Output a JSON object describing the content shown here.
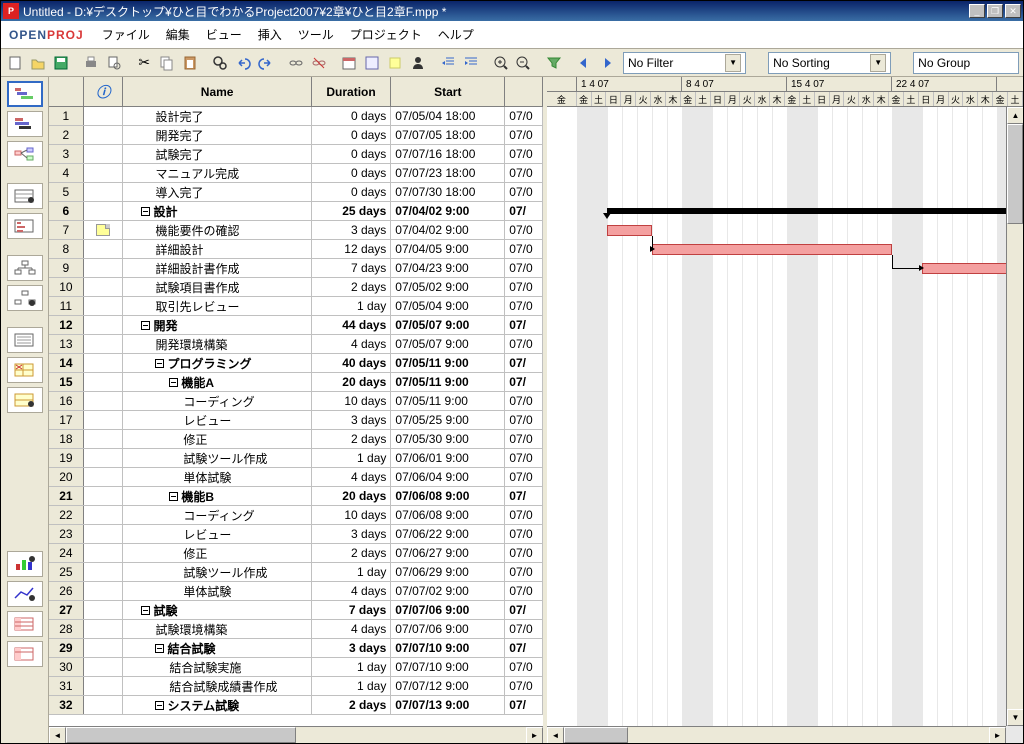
{
  "window": {
    "title": "Untitled - D:¥デスクトップ¥ひと目でわかるProject2007¥2章¥ひと目2章F.mpp *"
  },
  "logo": {
    "open": "OPEN",
    "proj": "PROJ"
  },
  "menu": {
    "file": "ファイル",
    "edit": "編集",
    "view": "ビュー",
    "insert": "挿入",
    "tool": "ツール",
    "project": "プロジェクト",
    "help": "ヘルプ"
  },
  "combos": {
    "filter": "No Filter",
    "sort": "No Sorting",
    "group": "No Group"
  },
  "headers": {
    "indicator": "ⓘ",
    "name": "Name",
    "duration": "Duration",
    "start": "Start"
  },
  "timeline": {
    "weeks": [
      "1 4 07",
      "8 4 07",
      "15 4 07",
      "22 4 07"
    ],
    "days": [
      "金",
      "土",
      "日",
      "月",
      "火",
      "水",
      "木",
      "金",
      "土",
      "日",
      "月",
      "火",
      "水",
      "木",
      "金",
      "土",
      "日",
      "月",
      "火",
      "水",
      "木",
      "金",
      "土",
      "日",
      "月",
      "火",
      "水",
      "木",
      "金",
      "土"
    ]
  },
  "tasks": [
    {
      "id": 1,
      "ind": "",
      "name": "設計完了",
      "dur": "0 days",
      "start": "07/05/04 18:00",
      "fin": "07/0",
      "indent": 2,
      "sum": false
    },
    {
      "id": 2,
      "ind": "",
      "name": "開発完了",
      "dur": "0 days",
      "start": "07/07/05 18:00",
      "fin": "07/0",
      "indent": 2,
      "sum": false
    },
    {
      "id": 3,
      "ind": "",
      "name": "試験完了",
      "dur": "0 days",
      "start": "07/07/16 18:00",
      "fin": "07/0",
      "indent": 2,
      "sum": false
    },
    {
      "id": 4,
      "ind": "",
      "name": "マニュアル完成",
      "dur": "0 days",
      "start": "07/07/23 18:00",
      "fin": "07/0",
      "indent": 2,
      "sum": false
    },
    {
      "id": 5,
      "ind": "",
      "name": "導入完了",
      "dur": "0 days",
      "start": "07/07/30 18:00",
      "fin": "07/0",
      "indent": 2,
      "sum": false
    },
    {
      "id": 6,
      "ind": "",
      "name": "設計",
      "dur": "25 days",
      "start": "07/04/02 9:00",
      "fin": "07/",
      "indent": 1,
      "sum": true
    },
    {
      "id": 7,
      "ind": "note",
      "name": "機能要件の確認",
      "dur": "3 days",
      "start": "07/04/02 9:00",
      "fin": "07/0",
      "indent": 2,
      "sum": false
    },
    {
      "id": 8,
      "ind": "",
      "name": "詳細設計",
      "dur": "12 days",
      "start": "07/04/05 9:00",
      "fin": "07/0",
      "indent": 2,
      "sum": false
    },
    {
      "id": 9,
      "ind": "",
      "name": "詳細設計書作成",
      "dur": "7 days",
      "start": "07/04/23 9:00",
      "fin": "07/0",
      "indent": 2,
      "sum": false
    },
    {
      "id": 10,
      "ind": "",
      "name": "試験項目書作成",
      "dur": "2 days",
      "start": "07/05/02 9:00",
      "fin": "07/0",
      "indent": 2,
      "sum": false
    },
    {
      "id": 11,
      "ind": "",
      "name": "取引先レビュー",
      "dur": "1 day",
      "start": "07/05/04 9:00",
      "fin": "07/0",
      "indent": 2,
      "sum": false
    },
    {
      "id": 12,
      "ind": "",
      "name": "開発",
      "dur": "44 days",
      "start": "07/05/07 9:00",
      "fin": "07/",
      "indent": 1,
      "sum": true
    },
    {
      "id": 13,
      "ind": "",
      "name": "開発環境構築",
      "dur": "4 days",
      "start": "07/05/07 9:00",
      "fin": "07/0",
      "indent": 2,
      "sum": false
    },
    {
      "id": 14,
      "ind": "",
      "name": "プログラミング",
      "dur": "40 days",
      "start": "07/05/11 9:00",
      "fin": "07/",
      "indent": 2,
      "sum": true
    },
    {
      "id": 15,
      "ind": "",
      "name": "機能A",
      "dur": "20 days",
      "start": "07/05/11 9:00",
      "fin": "07/",
      "indent": 3,
      "sum": true
    },
    {
      "id": 16,
      "ind": "",
      "name": "コーディング",
      "dur": "10 days",
      "start": "07/05/11 9:00",
      "fin": "07/0",
      "indent": 4,
      "sum": false
    },
    {
      "id": 17,
      "ind": "",
      "name": "レビュー",
      "dur": "3 days",
      "start": "07/05/25 9:00",
      "fin": "07/0",
      "indent": 4,
      "sum": false
    },
    {
      "id": 18,
      "ind": "",
      "name": "修正",
      "dur": "2 days",
      "start": "07/05/30 9:00",
      "fin": "07/0",
      "indent": 4,
      "sum": false
    },
    {
      "id": 19,
      "ind": "",
      "name": "試験ツール作成",
      "dur": "1 day",
      "start": "07/06/01 9:00",
      "fin": "07/0",
      "indent": 4,
      "sum": false
    },
    {
      "id": 20,
      "ind": "",
      "name": "単体試験",
      "dur": "4 days",
      "start": "07/06/04 9:00",
      "fin": "07/0",
      "indent": 4,
      "sum": false
    },
    {
      "id": 21,
      "ind": "",
      "name": "機能B",
      "dur": "20 days",
      "start": "07/06/08 9:00",
      "fin": "07/",
      "indent": 3,
      "sum": true
    },
    {
      "id": 22,
      "ind": "",
      "name": "コーディング",
      "dur": "10 days",
      "start": "07/06/08 9:00",
      "fin": "07/0",
      "indent": 4,
      "sum": false
    },
    {
      "id": 23,
      "ind": "",
      "name": "レビュー",
      "dur": "3 days",
      "start": "07/06/22 9:00",
      "fin": "07/0",
      "indent": 4,
      "sum": false
    },
    {
      "id": 24,
      "ind": "",
      "name": "修正",
      "dur": "2 days",
      "start": "07/06/27 9:00",
      "fin": "07/0",
      "indent": 4,
      "sum": false
    },
    {
      "id": 25,
      "ind": "",
      "name": "試験ツール作成",
      "dur": "1 day",
      "start": "07/06/29 9:00",
      "fin": "07/0",
      "indent": 4,
      "sum": false
    },
    {
      "id": 26,
      "ind": "",
      "name": "単体試験",
      "dur": "4 days",
      "start": "07/07/02 9:00",
      "fin": "07/0",
      "indent": 4,
      "sum": false
    },
    {
      "id": 27,
      "ind": "",
      "name": "試験",
      "dur": "7 days",
      "start": "07/07/06 9:00",
      "fin": "07/",
      "indent": 1,
      "sum": true
    },
    {
      "id": 28,
      "ind": "",
      "name": "試験環境構築",
      "dur": "4 days",
      "start": "07/07/06 9:00",
      "fin": "07/0",
      "indent": 2,
      "sum": false
    },
    {
      "id": 29,
      "ind": "",
      "name": "結合試験",
      "dur": "3 days",
      "start": "07/07/10 9:00",
      "fin": "07/",
      "indent": 2,
      "sum": true
    },
    {
      "id": 30,
      "ind": "",
      "name": "結合試験実施",
      "dur": "1 day",
      "start": "07/07/10 9:00",
      "fin": "07/0",
      "indent": 3,
      "sum": false
    },
    {
      "id": 31,
      "ind": "",
      "name": "結合試験成績書作成",
      "dur": "1 day",
      "start": "07/07/12 9:00",
      "fin": "07/0",
      "indent": 3,
      "sum": false
    },
    {
      "id": 32,
      "ind": "",
      "name": "システム試験",
      "dur": "2 days",
      "start": "07/07/13 9:00",
      "fin": "07/",
      "indent": 2,
      "sum": true
    }
  ]
}
